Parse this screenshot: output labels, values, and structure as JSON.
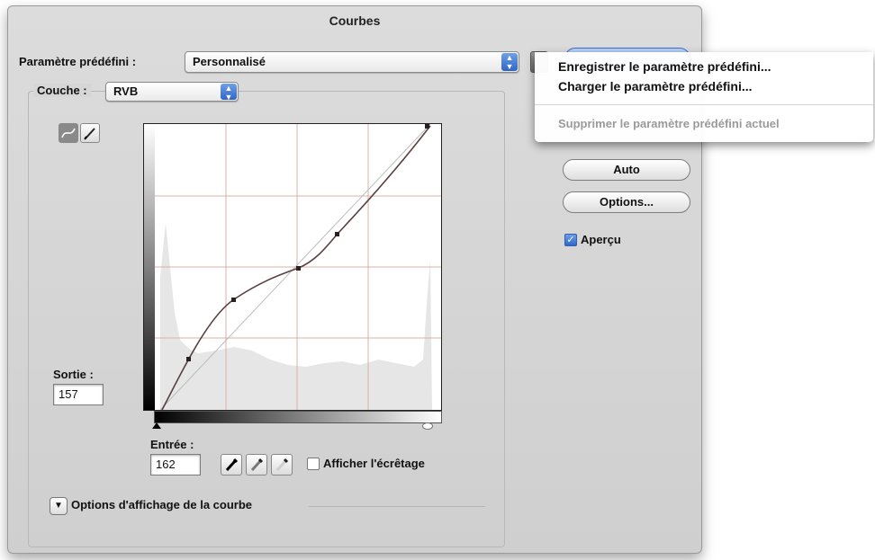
{
  "dialog": {
    "title": "Courbes",
    "preset": {
      "label": "Paramètre prédéfini :",
      "value": "Personnalisé"
    },
    "channel": {
      "label": "Couche :",
      "value": "RVB"
    },
    "output": {
      "label": "Sortie :",
      "value": "157"
    },
    "input": {
      "label": "Entrée :",
      "value": "162"
    },
    "show_clipping_label": "Afficher l'écrêtage",
    "curve_display_options_label": "Options d'affichage de la courbe",
    "buttons": {
      "auto": "Auto",
      "options": "Options..."
    },
    "preview": {
      "label": "Aperçu",
      "checked": true
    }
  },
  "preset_menu": {
    "items": [
      {
        "label": "Enregistrer le paramètre prédéfini...",
        "enabled": true
      },
      {
        "label": "Charger le paramètre prédéfini...",
        "enabled": true
      },
      {
        "label": "Supprimer le paramètre prédéfini actuel",
        "enabled": false
      }
    ]
  },
  "icons": [
    "curve-tool-icon",
    "pencil-tool-icon",
    "black-point-eyedropper-icon",
    "gray-point-eyedropper-icon",
    "white-point-eyedropper-icon",
    "disclosure-triangle-icon",
    "preset-options-icon"
  ],
  "colors": {
    "accent": "#3f76d6",
    "curve": "#5a4040",
    "grid_line": "#d9b0a8",
    "histogram": "#e6e6e6"
  }
}
